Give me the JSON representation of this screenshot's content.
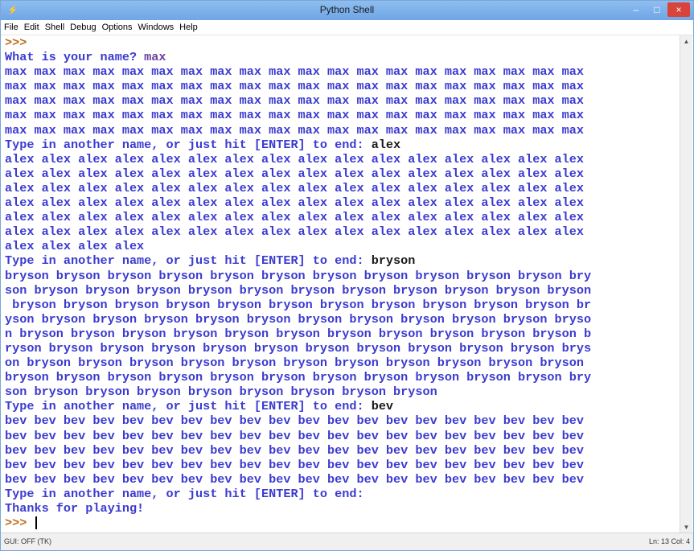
{
  "window": {
    "title": "Python Shell",
    "icon": "python-icon",
    "controls": {
      "minimize": "–",
      "maximize": "□",
      "close": "×"
    }
  },
  "menubar": [
    "File",
    "Edit",
    "Shell",
    "Debug",
    "Options",
    "Windows",
    "Help"
  ],
  "shell": {
    "lines": [
      [
        {
          "t": ">>>",
          "c": "prompt"
        }
      ],
      [
        {
          "t": "What is your name? ",
          "c": "out"
        },
        {
          "t": "max",
          "c": "inp"
        }
      ],
      [
        {
          "t": "max max max max max max max max max max max max max max max max max max max max",
          "c": "out"
        }
      ],
      [
        {
          "t": "max max max max max max max max max max max max max max max max max max max max",
          "c": "out"
        }
      ],
      [
        {
          "t": "max max max max max max max max max max max max max max max max max max max max",
          "c": "out"
        }
      ],
      [
        {
          "t": "max max max max max max max max max max max max max max max max max max max max",
          "c": "out"
        }
      ],
      [
        {
          "t": "max max max max max max max max max max max max max max max max max max max max",
          "c": "out"
        }
      ],
      [
        {
          "t": "Type in another name, or just hit [ENTER] to end: ",
          "c": "out"
        },
        {
          "t": "alex",
          "c": "inp-b"
        }
      ],
      [
        {
          "t": "alex alex alex alex alex alex alex alex alex alex alex alex alex alex alex alex",
          "c": "out"
        }
      ],
      [
        {
          "t": "alex alex alex alex alex alex alex alex alex alex alex alex alex alex alex alex",
          "c": "out"
        }
      ],
      [
        {
          "t": "alex alex alex alex alex alex alex alex alex alex alex alex alex alex alex alex",
          "c": "out"
        }
      ],
      [
        {
          "t": "alex alex alex alex alex alex alex alex alex alex alex alex alex alex alex alex",
          "c": "out"
        }
      ],
      [
        {
          "t": "alex alex alex alex alex alex alex alex alex alex alex alex alex alex alex alex",
          "c": "out"
        }
      ],
      [
        {
          "t": "alex alex alex alex alex alex alex alex alex alex alex alex alex alex alex alex",
          "c": "out"
        }
      ],
      [
        {
          "t": "alex alex alex alex",
          "c": "out"
        }
      ],
      [
        {
          "t": "Type in another name, or just hit [ENTER] to end: ",
          "c": "out"
        },
        {
          "t": "bryson",
          "c": "inp-b"
        }
      ],
      [
        {
          "t": "bryson bryson bryson bryson bryson bryson bryson bryson bryson bryson bryson bry",
          "c": "out"
        }
      ],
      [
        {
          "t": "son bryson bryson bryson bryson bryson bryson bryson bryson bryson bryson bryson",
          "c": "out"
        }
      ],
      [
        {
          "t": " bryson bryson bryson bryson bryson bryson bryson bryson bryson bryson bryson br",
          "c": "out"
        }
      ],
      [
        {
          "t": "yson bryson bryson bryson bryson bryson bryson bryson bryson bryson bryson bryso",
          "c": "out"
        }
      ],
      [
        {
          "t": "n bryson bryson bryson bryson bryson bryson bryson bryson bryson bryson bryson b",
          "c": "out"
        }
      ],
      [
        {
          "t": "ryson bryson bryson bryson bryson bryson bryson bryson bryson bryson bryson brys",
          "c": "out"
        }
      ],
      [
        {
          "t": "on bryson bryson bryson bryson bryson bryson bryson bryson bryson bryson bryson",
          "c": "out"
        }
      ],
      [
        {
          "t": "bryson bryson bryson bryson bryson bryson bryson bryson bryson bryson bryson bry",
          "c": "out"
        }
      ],
      [
        {
          "t": "son bryson bryson bryson bryson bryson bryson bryson bryson",
          "c": "out"
        }
      ],
      [
        {
          "t": "Type in another name, or just hit [ENTER] to end: ",
          "c": "out"
        },
        {
          "t": "bev",
          "c": "inp-b"
        }
      ],
      [
        {
          "t": "bev bev bev bev bev bev bev bev bev bev bev bev bev bev bev bev bev bev bev bev",
          "c": "out"
        }
      ],
      [
        {
          "t": "bev bev bev bev bev bev bev bev bev bev bev bev bev bev bev bev bev bev bev bev",
          "c": "out"
        }
      ],
      [
        {
          "t": "bev bev bev bev bev bev bev bev bev bev bev bev bev bev bev bev bev bev bev bev",
          "c": "out"
        }
      ],
      [
        {
          "t": "bev bev bev bev bev bev bev bev bev bev bev bev bev bev bev bev bev bev bev bev",
          "c": "out"
        }
      ],
      [
        {
          "t": "bev bev bev bev bev bev bev bev bev bev bev bev bev bev bev bev bev bev bev bev",
          "c": "out"
        }
      ],
      [
        {
          "t": "Type in another name, or just hit [ENTER] to end:",
          "c": "out"
        }
      ],
      [
        {
          "t": "Thanks for playing!",
          "c": "out"
        }
      ],
      [
        {
          "t": ">>> ",
          "c": "prompt"
        }
      ]
    ]
  },
  "statusbar": {
    "left": "GUI: OFF (TK)",
    "right": "Ln: 13 Col: 4"
  }
}
